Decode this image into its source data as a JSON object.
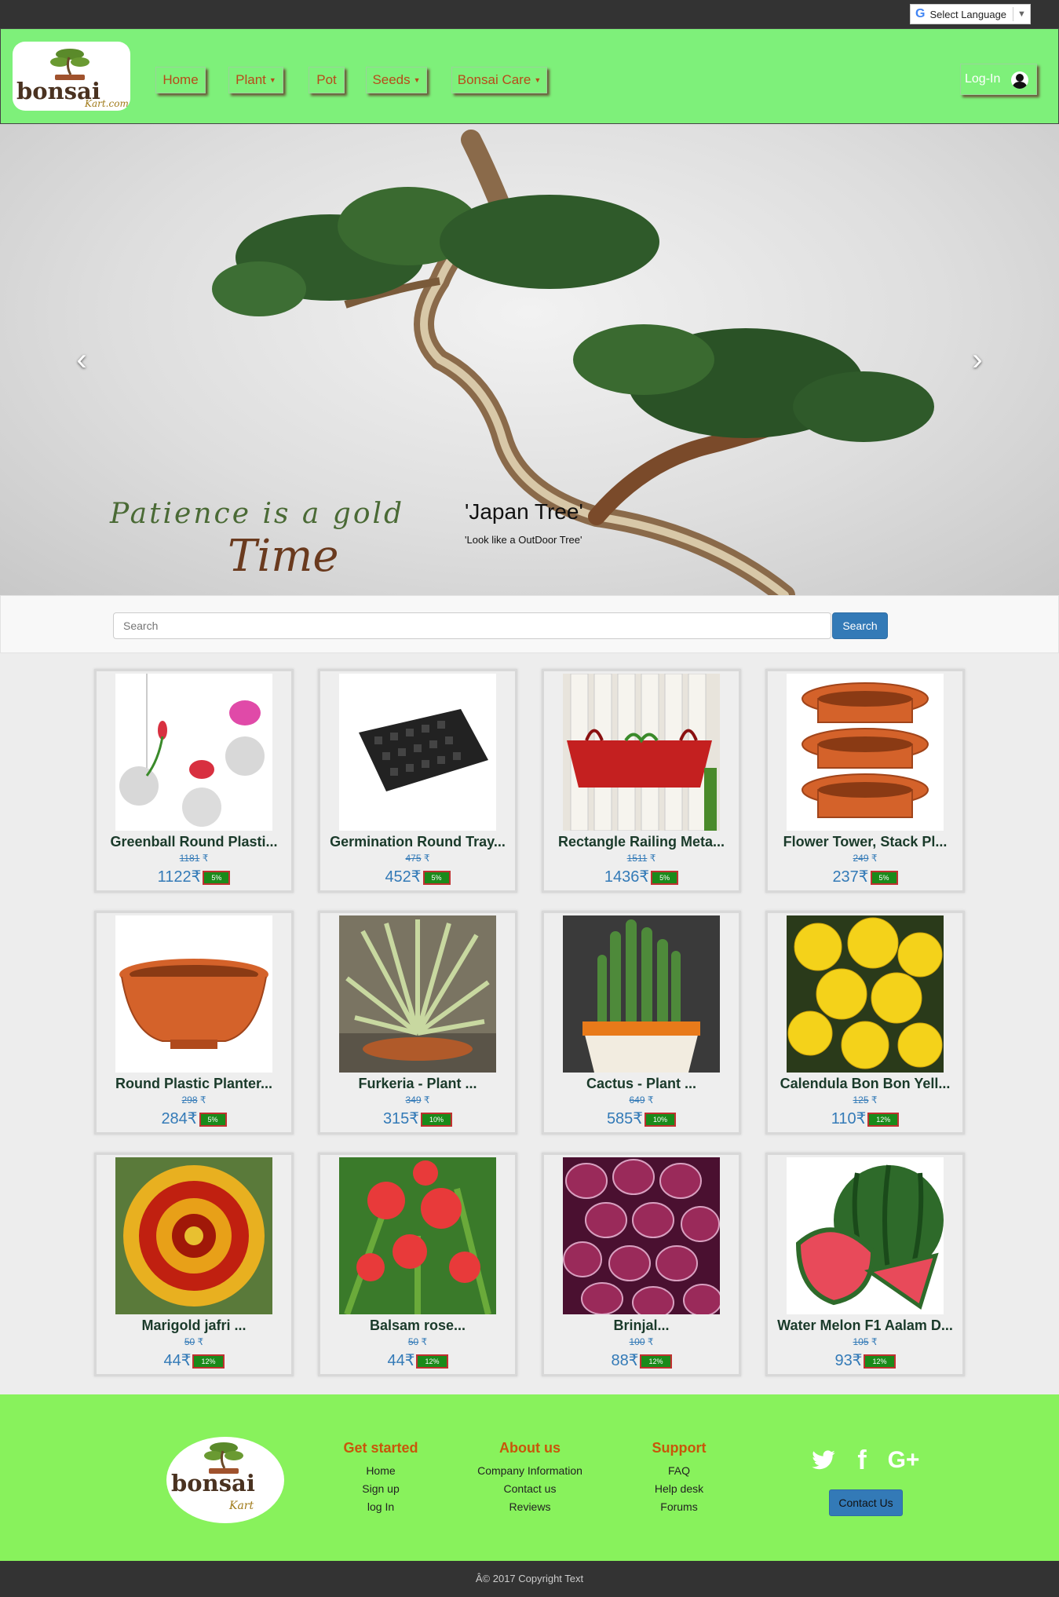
{
  "topbar": {
    "language_label": "Select Language",
    "language_arrow": "▼"
  },
  "header": {
    "logo_text": "bonsai",
    "logo_subtext": "Kart.com",
    "nav": [
      {
        "label": "Home"
      },
      {
        "label": "Plant"
      },
      {
        "label": "Pot"
      },
      {
        "label": "Seeds"
      },
      {
        "label": "Bonsai Care"
      }
    ],
    "login_label": "Log-In"
  },
  "banner": {
    "slogan_line1": "Patience is a gold",
    "slogan_line2": "Time",
    "caption_title": "'Japan Tree'",
    "caption_subtitle": "'Look like a OutDoor Tree'",
    "prev_arrow": "‹",
    "next_arrow": "›"
  },
  "search": {
    "placeholder": "Search",
    "button_label": "Search"
  },
  "currency": "₹",
  "products": [
    {
      "name": "Greenball Round Plasti...",
      "old_price": "1181",
      "price": "1122₹",
      "discount": "5%"
    },
    {
      "name": "Germination Round Tray...",
      "old_price": "475",
      "price": "452₹",
      "discount": "5%"
    },
    {
      "name": "Rectangle Railing Meta...",
      "old_price": "1511",
      "price": "1436₹",
      "discount": "5%"
    },
    {
      "name": "Flower Tower, Stack Pl...",
      "old_price": "249",
      "price": "237₹",
      "discount": "5%"
    },
    {
      "name": "Round Plastic Planter...",
      "old_price": "298",
      "price": "284₹",
      "discount": "5%"
    },
    {
      "name": "Furkeria - Plant ...",
      "old_price": "349",
      "price": "315₹",
      "discount": "10%"
    },
    {
      "name": "Cactus - Plant ...",
      "old_price": "649",
      "price": "585₹",
      "discount": "10%"
    },
    {
      "name": "Calendula Bon Bon Yell...",
      "old_price": "125",
      "price": "110₹",
      "discount": "12%"
    },
    {
      "name": "Marigold jafri ...",
      "old_price": "50",
      "price": "44₹",
      "discount": "12%"
    },
    {
      "name": "Balsam rose...",
      "old_price": "50",
      "price": "44₹",
      "discount": "12%"
    },
    {
      "name": "Brinjal...",
      "old_price": "100",
      "price": "88₹",
      "discount": "12%"
    },
    {
      "name": "Water Melon F1 Aalam D...",
      "old_price": "105",
      "price": "93₹",
      "discount": "12%"
    }
  ],
  "footer": {
    "logo_text": "bonsai",
    "logo_subtext": "Kart",
    "columns": [
      {
        "title": "Get started",
        "links": [
          "Home",
          "Sign up",
          "log In"
        ]
      },
      {
        "title": "About us",
        "links": [
          "Company Information",
          "Contact us",
          "Reviews"
        ]
      },
      {
        "title": "Support",
        "links": [
          "FAQ",
          "Help desk",
          "Forums"
        ]
      }
    ],
    "social": {
      "twitter": "🐦",
      "facebook": "f",
      "google": "G+"
    },
    "contact_button": "Contact Us",
    "copyright": "Â© 2017 Copyright Text"
  },
  "colors": {
    "header_bg": "#7ef07a",
    "footer_bg": "#88f25c",
    "link_blue": "#337ab7",
    "nav_text": "#b84a1a",
    "footer_heading": "#c8560a"
  }
}
